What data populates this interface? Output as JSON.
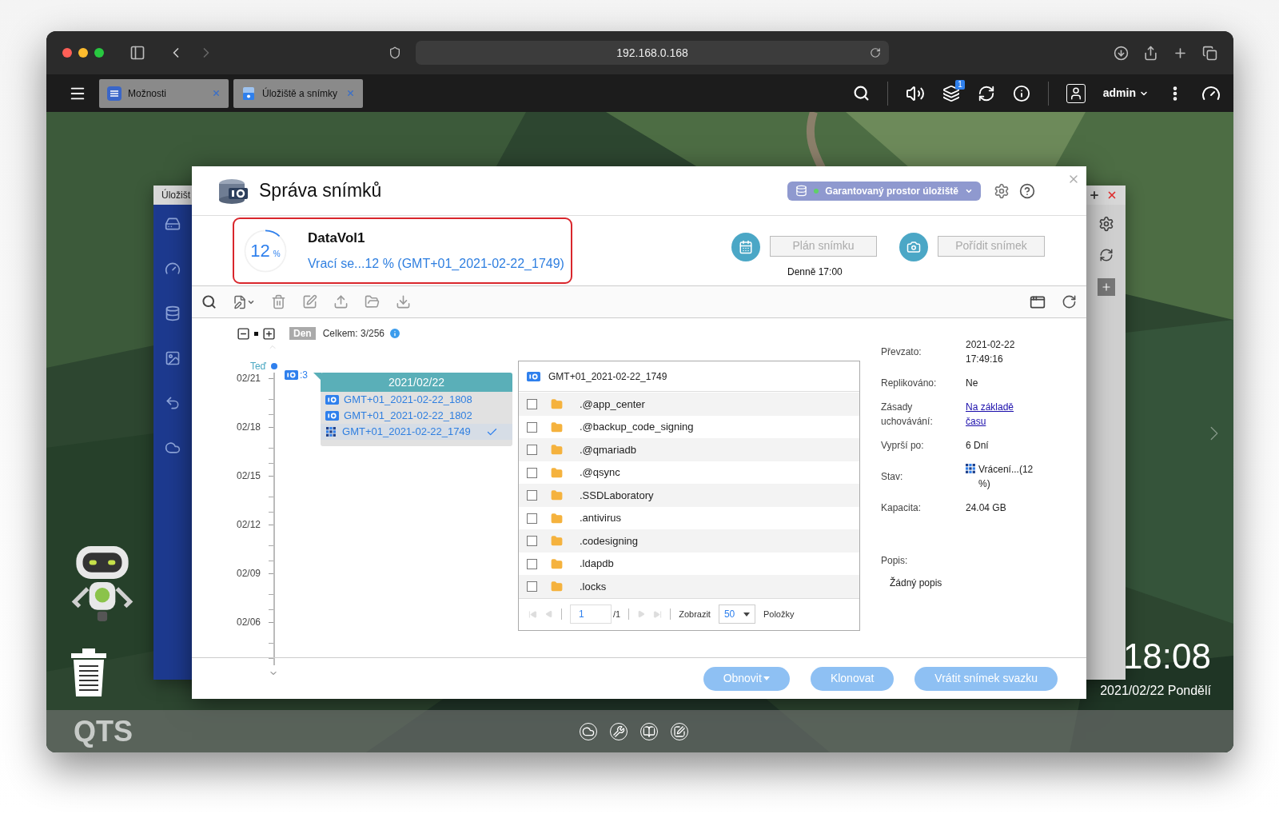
{
  "browser": {
    "url": "192.168.0.168"
  },
  "topbar": {
    "tabs": [
      {
        "label": "Možnosti"
      },
      {
        "label": "Úložiště a snímky"
      }
    ],
    "badge": "1",
    "user": "admin"
  },
  "background_window": {
    "title": "Úložišt"
  },
  "dialog": {
    "title": "Správa snímků",
    "space_button": "Garantovaný prostor úložiště",
    "volume": {
      "name": "DataVol1",
      "percent": "12",
      "unit": "%",
      "status": "Vrací se...12 % (GMT+01_2021-02-22_1749)",
      "level": 0.12
    },
    "schedule": {
      "button": "Plán snímku",
      "disabled": true,
      "time": "Denně 17:00"
    },
    "take": {
      "button": "Pořídit snímek",
      "disabled": true
    },
    "timeline": {
      "mode": "Den",
      "total": "Celkem: 3/256",
      "now": "Teď",
      "count": ":3",
      "dates": [
        "02/21",
        "02/18",
        "02/15",
        "02/12",
        "02/09",
        "02/06"
      ],
      "group": {
        "date": "2021/02/22",
        "snapshots": [
          {
            "name": "GMT+01_2021-02-22_1808",
            "kind": "snapshot",
            "selected": false
          },
          {
            "name": "GMT+01_2021-02-22_1802",
            "kind": "snapshot",
            "selected": false
          },
          {
            "name": "GMT+01_2021-02-22_1749",
            "kind": "reverting",
            "selected": true
          }
        ]
      }
    },
    "browser_panel": {
      "title": "GMT+01_2021-02-22_1749",
      "files": [
        {
          "name": ".@app_center",
          "checked": false
        },
        {
          "name": ".@backup_code_signing",
          "checked": false
        },
        {
          "name": ".@qmariadb",
          "checked": false
        },
        {
          "name": ".@qsync",
          "checked": false
        },
        {
          "name": ".SSDLaboratory",
          "checked": false
        },
        {
          "name": ".antivirus",
          "checked": false
        },
        {
          "name": ".codesigning",
          "checked": false
        },
        {
          "name": ".ldapdb",
          "checked": false
        },
        {
          "name": ".locks",
          "checked": false
        }
      ],
      "pager": {
        "page": "1",
        "pages": "/1",
        "show_label": "Zobrazit",
        "per_page": "50",
        "items_label": "Položky"
      }
    },
    "details": {
      "fields": [
        {
          "label": "Převzato:",
          "value": "2021-02-22 17:49:16",
          "kind": "text"
        },
        {
          "label": "Replikováno:",
          "value": "Ne",
          "kind": "text"
        },
        {
          "label": "Zásady uchovávání:",
          "value": "Na základě času",
          "kind": "link"
        },
        {
          "label": "Vyprší po:",
          "value": "6 Dní",
          "kind": "text"
        },
        {
          "label": "Stav:",
          "value": "Vrácení...(12 %)",
          "kind": "status"
        },
        {
          "label": "Kapacita:",
          "value": "24.04 GB",
          "kind": "text"
        }
      ],
      "description_label": "Popis:",
      "description": "Žádný popis"
    },
    "footer": {
      "buttons": [
        {
          "label": "Obnovit",
          "dropdown": true
        },
        {
          "label": "Klonovat",
          "dropdown": false
        },
        {
          "label": "Vrátit snímek svazku",
          "dropdown": false
        }
      ]
    }
  },
  "desktop": {
    "time": "18:08",
    "date": "2021/02/22 Pondělí",
    "dock_logo": "QTS"
  }
}
